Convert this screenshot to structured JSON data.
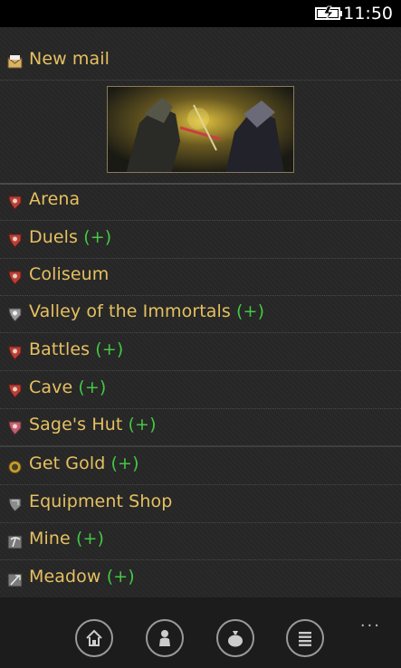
{
  "status": {
    "time": "11:50",
    "battery_icon": "battery-charging-icon"
  },
  "mail": {
    "label": "New mail",
    "icon": "envelope-icon"
  },
  "banner": {
    "alt_icon": "battle-banner-image"
  },
  "menu": [
    {
      "label": "Arena",
      "plus": "",
      "icon": "crest-red-icon"
    },
    {
      "label": "Duels",
      "plus": "(+)",
      "icon": "crest-red-icon"
    },
    {
      "label": "Coliseum",
      "plus": "",
      "icon": "crest-red-icon"
    },
    {
      "label": "Valley of the Immortals",
      "plus": "(+)",
      "icon": "crest-grey-icon"
    },
    {
      "label": "Battles",
      "plus": "(+)",
      "icon": "crest-red-icon"
    },
    {
      "label": "Cave",
      "plus": "(+)",
      "icon": "crest-red-icon"
    },
    {
      "label": "Sage's Hut",
      "plus": "(+)",
      "icon": "crest-pink-icon"
    },
    {
      "label": "Get Gold",
      "plus": "(+)",
      "icon": "gold-coin-icon"
    },
    {
      "label": "Equipment Shop",
      "plus": "",
      "icon": "shield-icon"
    },
    {
      "label": "Mine",
      "plus": "(+)",
      "icon": "pickaxe-icon"
    },
    {
      "label": "Meadow",
      "plus": "(+)",
      "icon": "scythe-icon"
    }
  ],
  "appbar": {
    "buttons": [
      "home-icon",
      "character-icon",
      "bag-icon",
      "list-icon"
    ],
    "more": "..."
  },
  "colors": {
    "accent": "#e6c060",
    "plus": "#43c843",
    "background": "#262626"
  }
}
